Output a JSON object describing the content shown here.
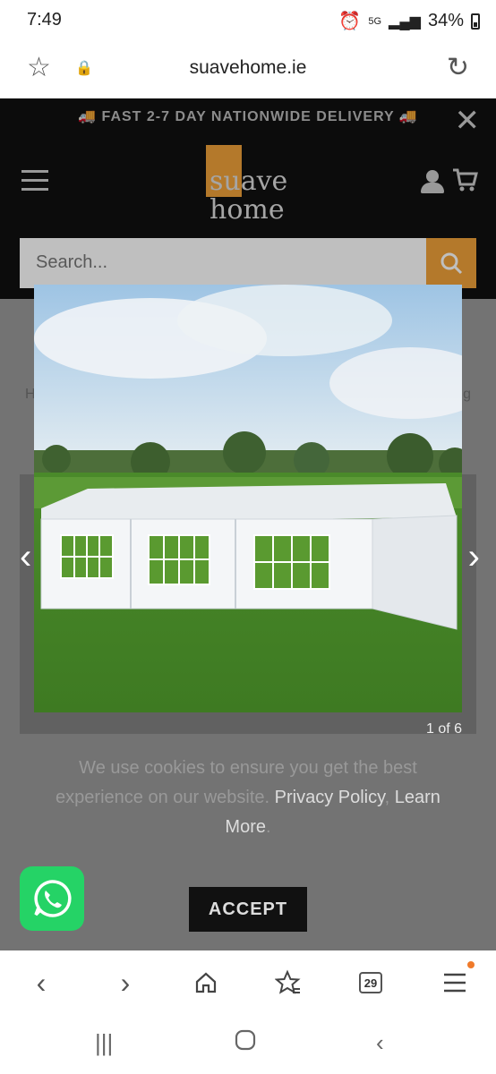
{
  "status_bar": {
    "time": "7:49",
    "network": "5G",
    "battery": "34%"
  },
  "browser": {
    "url": "suavehome.ie",
    "tabs_count": "29"
  },
  "site": {
    "announcement": "🚚 FAST 2-7 DAY NATIONWIDE DELIVERY 🚚",
    "logo_line1": "suave",
    "logo_line2": "home",
    "search_placeholder": "Search..."
  },
  "lightbox": {
    "counter": "1 of 6"
  },
  "cookie": {
    "text": "We use cookies to ensure you get the best experience on our website.",
    "privacy_link": "Privacy Policy",
    "separator": ",",
    "learn_more_link": "Learn More",
    "end": ".",
    "accept_label": "ACCEPT"
  },
  "colors": {
    "accent": "#f0a23a",
    "header_bg": "#111111",
    "whatsapp": "#25d366"
  }
}
